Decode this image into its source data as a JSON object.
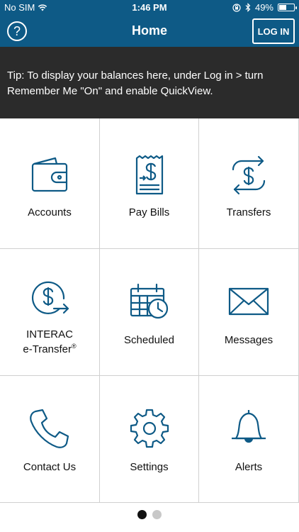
{
  "status_bar": {
    "carrier": "No SIM",
    "time": "1:46 PM",
    "battery_percent": "49%",
    "battery_level": 0.49
  },
  "nav": {
    "help_glyph": "?",
    "title": "Home",
    "login_label": "LOG IN"
  },
  "tip": {
    "text": "Tip: To display your balances here, under Log in > turn Remember Me \"On\" and enable QuickView."
  },
  "tiles": [
    {
      "label": "Accounts",
      "icon": "wallet-icon"
    },
    {
      "label": "Pay Bills",
      "icon": "bill-icon"
    },
    {
      "label": "Transfers",
      "icon": "transfer-icon"
    },
    {
      "label_line1": "INTERAC",
      "label_line2": "e-Transfer",
      "label_sup": "®",
      "icon": "e-transfer-icon"
    },
    {
      "label": "Scheduled",
      "icon": "calendar-clock-icon"
    },
    {
      "label": "Messages",
      "icon": "envelope-icon"
    },
    {
      "label": "Contact Us",
      "icon": "phone-icon"
    },
    {
      "label": "Settings",
      "icon": "gear-icon"
    },
    {
      "label": "Alerts",
      "icon": "bell-icon"
    }
  ],
  "pager": {
    "pages": 2,
    "active_index": 0
  },
  "colors": {
    "brand": "#0e5a86",
    "icon": "#0e5a86",
    "tip_bg": "#2b2b2b",
    "grid_line": "#d0d0d0"
  }
}
